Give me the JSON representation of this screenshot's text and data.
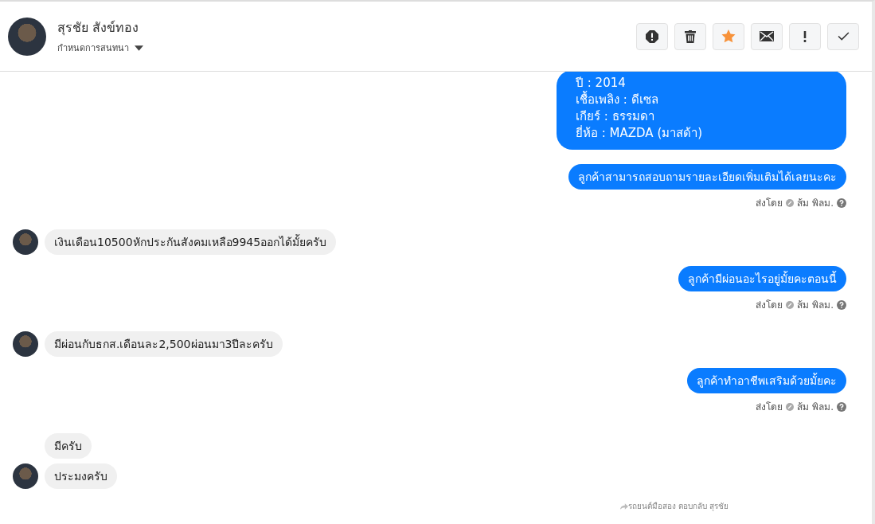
{
  "header": {
    "name": "สุรชัย สังข์ทอง",
    "subtitle": "กำหนดการสนทนา"
  },
  "actions": [
    {
      "kind": "alert",
      "on": false
    },
    {
      "kind": "trash",
      "on": false
    },
    {
      "kind": "star",
      "on": true
    },
    {
      "kind": "mail",
      "on": false
    },
    {
      "kind": "important",
      "on": false
    },
    {
      "kind": "done",
      "on": false
    }
  ],
  "messages": [
    {
      "kind": "out",
      "lines": [
        "ปี : 2014",
        "เชื้อเพลิง : ดีเซล",
        "เกียร์ : ธรรมดา",
        "ยี่ห้อ : MAZDA (มาสด้า)"
      ]
    },
    {
      "kind": "out",
      "lines": [
        "ลูกค้าสามารถสอบถามรายละเอียดเพิ่มเติมได้เลยนะคะ"
      ],
      "sent_by": "ส่งโดย",
      "sender": "ส้ม พิลม."
    },
    {
      "kind": "in",
      "lines": [
        "เงินเดือน10500หักประกันสังคมเหลือ9945ออกได้มั้ยครับ"
      ],
      "avatar": true
    },
    {
      "kind": "out",
      "lines": [
        "ลูกค้ามีผ่อนอะไรอยู่มั้ยคะตอนนี้"
      ],
      "sent_by": "ส่งโดย",
      "sender": "ส้ม พิลม."
    },
    {
      "kind": "in",
      "lines": [
        "มีผ่อนกับธกส.เดือนละ2,500ผ่อนมา3ปีละครับ"
      ],
      "avatar": true
    },
    {
      "kind": "out",
      "lines": [
        "ลูกค้าทำอาชีพเสริมด้วยมั้ยคะ"
      ],
      "sent_by": "ส่งโดย",
      "sender": "ส้ม พิลม."
    },
    {
      "kind": "in",
      "lines": [
        "มีครับ"
      ],
      "avatar": false
    },
    {
      "kind": "in",
      "lines": [
        "ประมงครับ"
      ],
      "avatar": true
    }
  ],
  "reply_note": "รถยนต์มือสอง ตอบกลับ สุรชัย"
}
